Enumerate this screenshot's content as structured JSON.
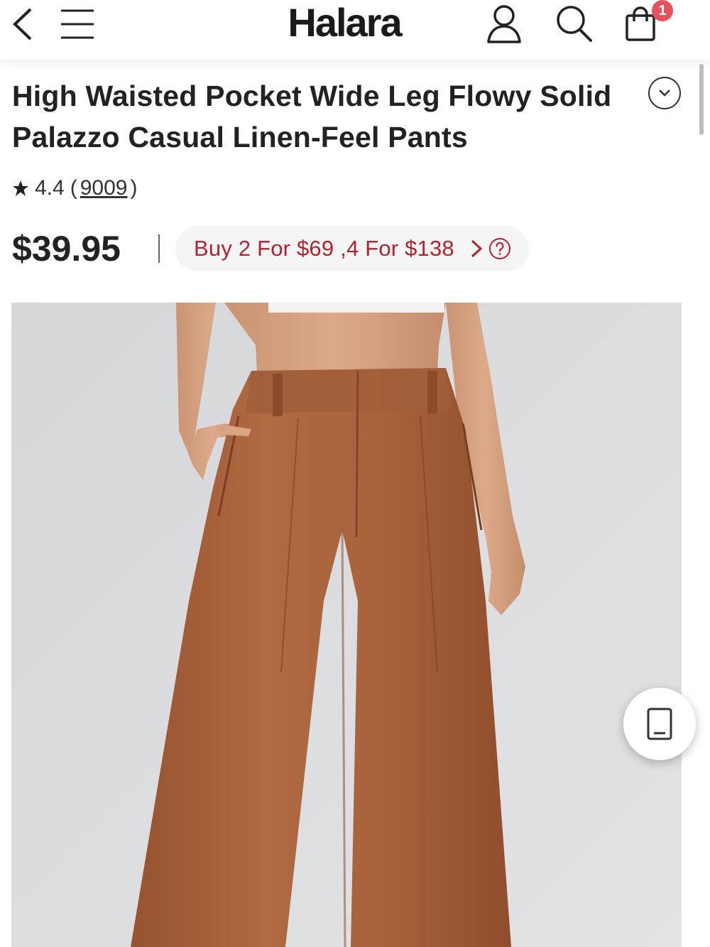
{
  "header": {
    "brand": "Halara",
    "back_icon": "chevron-left-icon",
    "menu_icon": "hamburger-menu-icon",
    "account_icon": "user-icon",
    "search_icon": "search-icon",
    "cart_icon": "shopping-bag-icon",
    "cart_count": "1"
  },
  "product": {
    "title": "High Waisted Pocket Wide Leg Flowy Solid Palazzo Casual Linen-Feel Pants",
    "rating": {
      "score": "4.4",
      "open_paren": "(",
      "reviews": "9009",
      "close_paren": ")"
    },
    "price": "$39.95",
    "promo": "Buy 2 For $69 ,4 For $138",
    "image_alt": "Model wearing brown wide leg palazzo pants"
  },
  "colors": {
    "accent_red": "#b3232e",
    "badge": "#e8505b",
    "pants": "#a8613c",
    "background_photo": "#d8dadd"
  }
}
